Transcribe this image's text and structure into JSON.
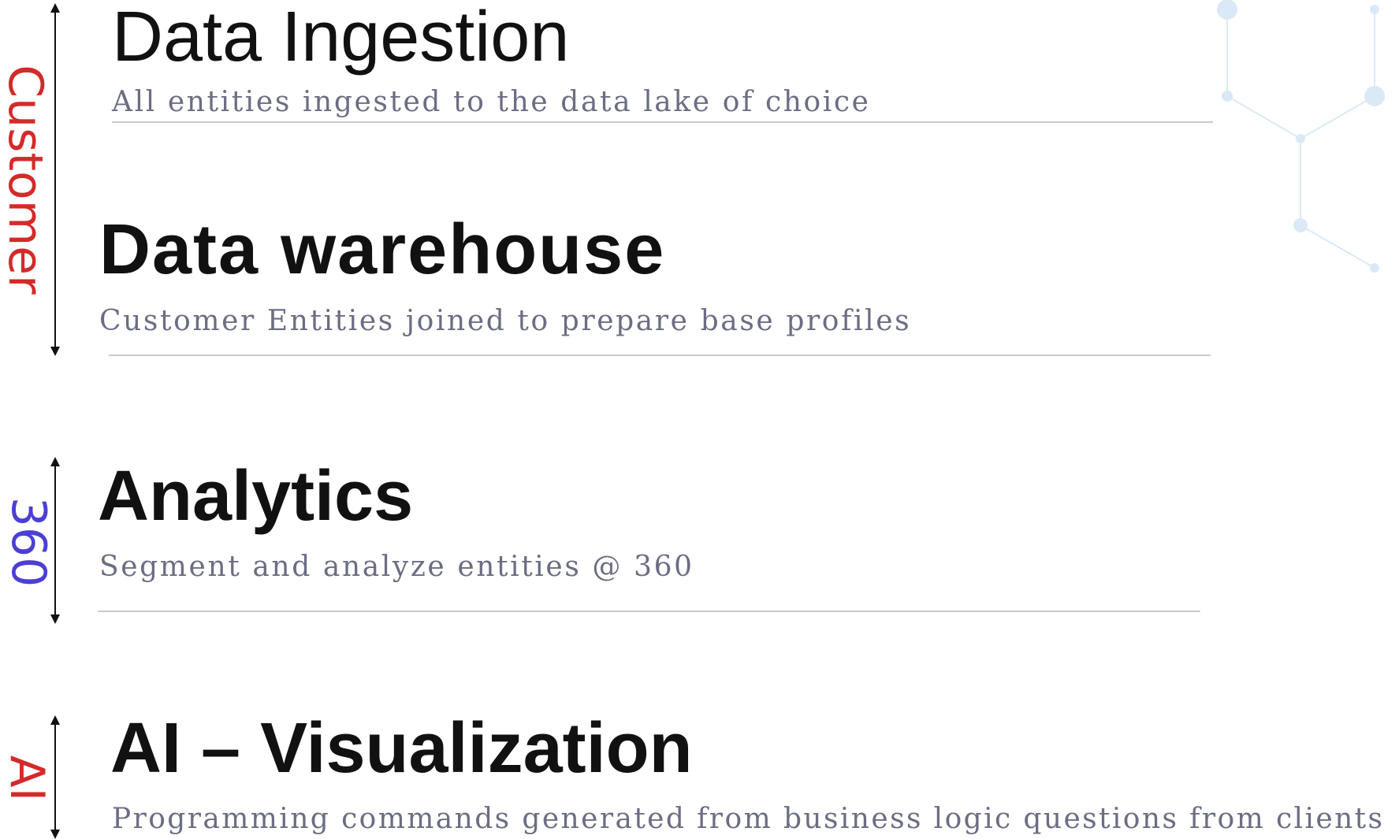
{
  "colors": {
    "customer": "#d42a2a",
    "three_sixty": "#4b3fd4",
    "ai": "#d42a2a",
    "title": "#111111",
    "subtitle": "#6b6e82",
    "rule": "#c9c9cf",
    "arrow": "#111111",
    "decor": "#dbe9f7"
  },
  "side_labels": {
    "customer": "Customer",
    "three_sixty": "360",
    "ai": "AI"
  },
  "sections": [
    {
      "title": "Data Ingestion",
      "subtitle": "All entities ingested to the data lake of choice"
    },
    {
      "title": "Data warehouse",
      "subtitle": "Customer Entities joined to prepare base profiles"
    },
    {
      "title": "Analytics",
      "subtitle": "Segment and analyze entities @ 360"
    },
    {
      "title": "AI – Visualization",
      "subtitle": "Programming commands generated from business logic questions from clients"
    }
  ]
}
